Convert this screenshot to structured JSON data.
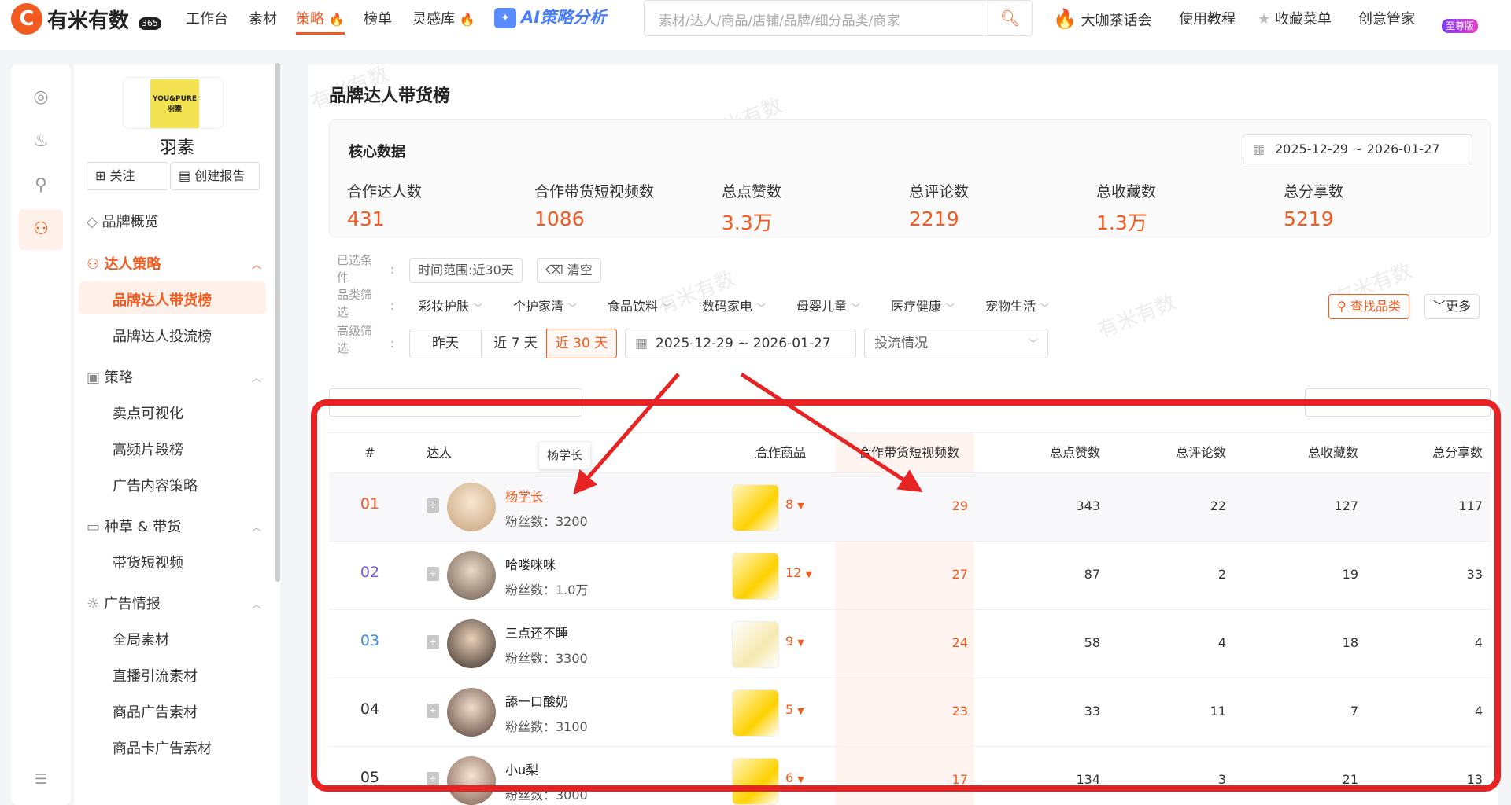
{
  "header": {
    "logo_text": "有米有数",
    "logo_badge": "365",
    "nav": [
      {
        "label": "工作台"
      },
      {
        "label": "素材"
      },
      {
        "label": "策略"
      },
      {
        "label": "榜单"
      },
      {
        "label": "灵感库"
      }
    ],
    "ai_label": "AI策略分析",
    "search_placeholder": "素材/达人/商品/店铺/品牌/细分品类/商家",
    "right": [
      {
        "label": "大咖茶话会"
      },
      {
        "label": "使用教程"
      },
      {
        "label": "收藏菜单"
      },
      {
        "label": "创意管家"
      }
    ],
    "vip_label": "至尊版"
  },
  "sidebar": {
    "brand_logo_text": "YOU&PURE 羽素",
    "brand_name": "羽素",
    "follow_label": "关注",
    "report_label": "创建报告",
    "items": [
      {
        "label": "品牌概览"
      },
      {
        "label": "达人策略"
      },
      {
        "label": "品牌达人带货榜"
      },
      {
        "label": "品牌达人投流榜"
      },
      {
        "label": "策略"
      },
      {
        "label": "卖点可视化"
      },
      {
        "label": "高频片段榜"
      },
      {
        "label": "广告内容策略"
      },
      {
        "label": "种草 & 带货"
      },
      {
        "label": "带货短视频"
      },
      {
        "label": "广告情报"
      },
      {
        "label": "全局素材"
      },
      {
        "label": "直播引流素材"
      },
      {
        "label": "商品广告素材"
      },
      {
        "label": "商品卡广告素材"
      }
    ]
  },
  "main": {
    "title": "品牌达人带货榜",
    "core": {
      "title": "核心数据",
      "date_range": "2025-12-29 ~ 2026-01-27",
      "metrics": [
        {
          "label": "合作达人数",
          "value": "431"
        },
        {
          "label": "合作带货短视频数",
          "value": "1086"
        },
        {
          "label": "总点赞数",
          "value": "3.3万"
        },
        {
          "label": "总评论数",
          "value": "2219"
        },
        {
          "label": "总收藏数",
          "value": "1.3万"
        },
        {
          "label": "总分享数",
          "value": "5219"
        }
      ]
    },
    "filters": {
      "selected_label": "已选条件",
      "selected_tag": "时间范围:近30天",
      "clear_label": "清空",
      "category_label": "品类筛选",
      "categories": [
        "彩妆护肤",
        "个护家清",
        "食品饮料",
        "数码家电",
        "母婴儿童",
        "医疗健康",
        "宠物生活"
      ],
      "find_category": "查找品类",
      "more": "更多",
      "advanced_label": "高级筛选",
      "time_options": [
        "昨天",
        "近 7 天",
        "近 30 天"
      ],
      "date_range": "2025-12-29 ~ 2026-01-27",
      "flow_placeholder": "投流情况"
    },
    "table": {
      "headers": {
        "rank": "#",
        "talent": "达人",
        "product": "合作商品",
        "videos": "合作带货短视频数",
        "likes": "总点赞数",
        "comments": "总评论数",
        "favorites": "总收藏数",
        "shares": "总分享数"
      },
      "tooltip": "杨学长",
      "rows": [
        {
          "rank": "01",
          "name": "杨学长",
          "fans": "粉丝数：3200",
          "products": "8",
          "videos": "29",
          "likes": "343",
          "comments": "22",
          "favorites": "127",
          "shares": "117"
        },
        {
          "rank": "02",
          "name": "哈喽咪咪",
          "fans": "粉丝数：1.0万",
          "products": "12",
          "videos": "27",
          "likes": "87",
          "comments": "2",
          "favorites": "19",
          "shares": "33"
        },
        {
          "rank": "03",
          "name": "三点还不睡",
          "fans": "粉丝数：3300",
          "products": "9",
          "videos": "24",
          "likes": "58",
          "comments": "4",
          "favorites": "18",
          "shares": "4"
        },
        {
          "rank": "04",
          "name": "舔一口酸奶",
          "fans": "粉丝数：3100",
          "products": "5",
          "videos": "23",
          "likes": "33",
          "comments": "11",
          "favorites": "7",
          "shares": "4"
        },
        {
          "rank": "05",
          "name": "小u梨",
          "fans": "粉丝数：3000",
          "products": "6",
          "videos": "17",
          "likes": "134",
          "comments": "3",
          "favorites": "21",
          "shares": "13"
        }
      ]
    }
  },
  "colors": {
    "accent": "#f25a1f",
    "annotation": "#e72323",
    "rank2": "#7b5cd6",
    "rank3": "#3a8de0"
  },
  "icons": [
    "search-icon",
    "fire-icon",
    "star-icon",
    "calendar-icon",
    "bookmark-icon",
    "chevron-down-icon",
    "annotation-arrow"
  ]
}
